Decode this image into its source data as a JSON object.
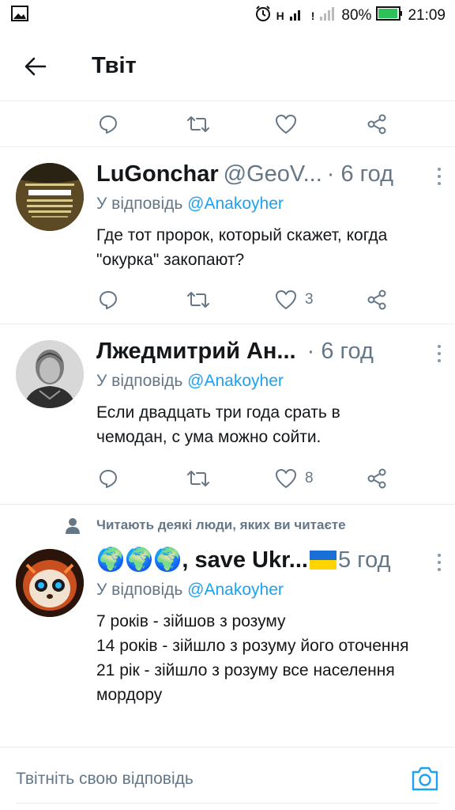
{
  "status_bar": {
    "network": "H",
    "signal_mark": "!",
    "battery": "80%",
    "time": "21:09",
    "icons": [
      "gallery-icon",
      "alarm-icon",
      "signal-icon",
      "battery-icon"
    ]
  },
  "header": {
    "back_icon": "arrow-left-icon",
    "title": "Твіт"
  },
  "colors": {
    "accent": "#1da1f2",
    "secondary_text": "#657786",
    "divider": "#e6ecf0"
  },
  "tweets": [
    {
      "author": "LuGonchar",
      "handle": "@GeoV...",
      "time": "· 6 год",
      "reply_prefix": "У відповідь",
      "reply_to": "@Anakoyher",
      "text": "Где тот пророк, который скажет, когда \"окурка\" закопают?",
      "likes": "3",
      "avatar_lettering": "ВОСПИТЫВАЮ ДОЧЬ ПОЭТОМУ САЖАТЬ ДЕРЕВО ИСТРОИТЬ ДОМ НЕ ВИЖУ СМЫСЛА"
    },
    {
      "author": "Лжедмитрий Ан...",
      "handle": "",
      "time": "· 6 год",
      "reply_prefix": "У відповідь",
      "reply_to": "@Anakoyher",
      "text": "Если двадцать три года срать в чемодан, с ума можно сойти.",
      "likes": "8"
    },
    {
      "author": "🌍🌍🌍, save Ukr...",
      "handle": "",
      "time": "5 год",
      "reply_prefix": "У відповідь",
      "reply_to": "@Anakoyher",
      "text_lines": [
        "7 років - зійшов з розуму",
        "14 років - зійшло з розуму його оточення",
        "21 рік - зійшло з розуму все населення мордору"
      ],
      "flag": "ukraine-flag"
    }
  ],
  "social_context": "Читають деякі люди, яких ви читаєте",
  "composer": {
    "placeholder": "Твітніть свою відповідь",
    "camera_icon": "camera-icon"
  }
}
